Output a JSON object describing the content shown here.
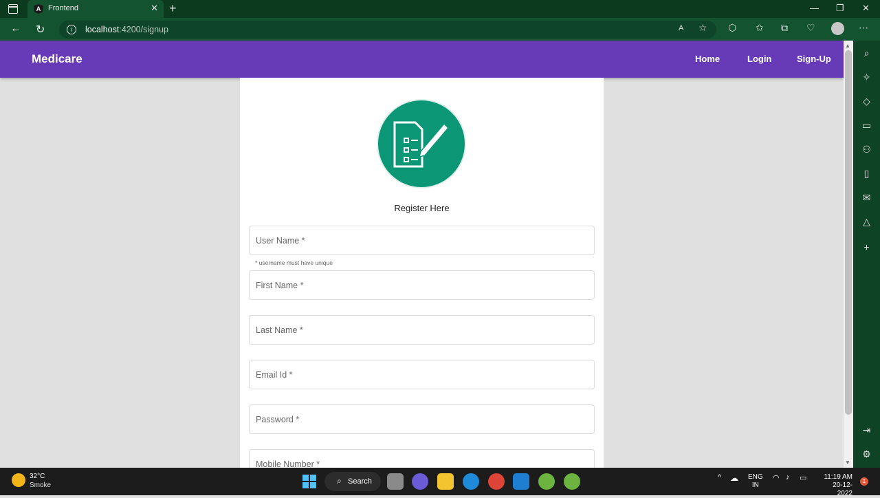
{
  "browser": {
    "tab_title": "Frontend",
    "tab_favicon_letter": "A",
    "url_host": "localhost",
    "url_rest": ":4200/signup"
  },
  "navbar": {
    "brand": "Medicare",
    "links": [
      "Home",
      "Login",
      "Sign-Up"
    ]
  },
  "form": {
    "heading": "Register Here",
    "fields": [
      "User Name *",
      "First Name *",
      "Last Name *",
      "Email Id *",
      "Password *",
      "Mobile Number *"
    ],
    "username_hint": "* username must have unique"
  },
  "taskbar": {
    "temperature": "32°C",
    "weather": "Smoke",
    "search_label": "Search",
    "lang_top": "ENG",
    "lang_bottom": "IN",
    "time": "11:19 AM",
    "date": "20-12-2022",
    "notification_count": "1"
  },
  "colors": {
    "navbar": "#673ab7",
    "logo": "#0b9776",
    "browser_chrome": "#14532f"
  }
}
